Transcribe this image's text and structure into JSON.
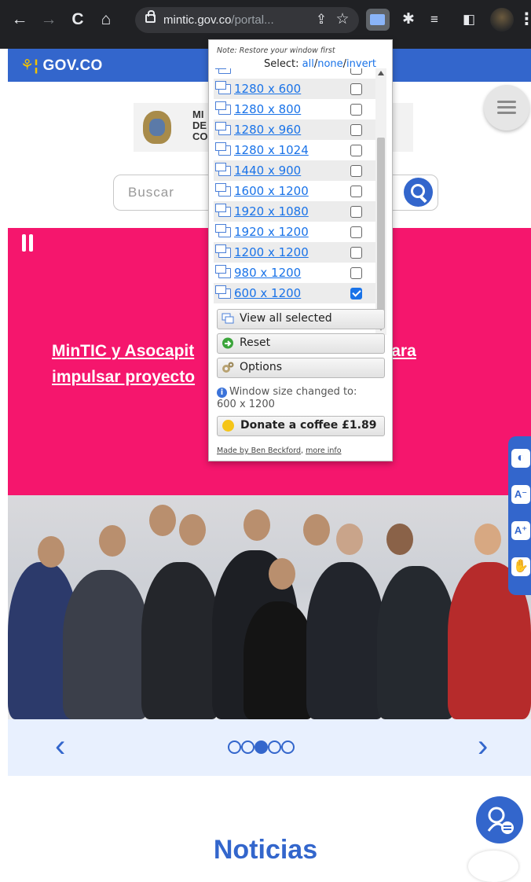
{
  "browser": {
    "url_host": "mintic.gov.co",
    "url_path": "/portal...",
    "icons": [
      "back-icon",
      "forward-icon",
      "reload-icon",
      "home-icon",
      "share-icon",
      "star-icon",
      "window-resizer-icon",
      "extensions-icon",
      "reading-list-icon",
      "side-panel-icon",
      "profile-avatar",
      "menu-icon"
    ]
  },
  "govbar": {
    "logo_text": "GOV.CO"
  },
  "header": {
    "ministry_lines": [
      "MI",
      "DE",
      "CO"
    ],
    "search_placeholder": "Buscar"
  },
  "hero": {
    "title_line1": "MinTIC y Asocapit",
    "title_line1_end": "uipo para",
    "title_line2": "impulsar proyecto"
  },
  "carousel": {
    "prev": "‹",
    "next": "›",
    "dots": 5,
    "active_dot": 3
  },
  "news": {
    "heading": "Noticias"
  },
  "accessibility": {
    "items": [
      "◐",
      "A⁻",
      "A⁺",
      "✋"
    ]
  },
  "popup": {
    "note": "Note: Restore your window first",
    "select_label": "Select:",
    "select_all": "all",
    "select_none": "none",
    "select_invert": "invert",
    "rows": [
      {
        "label": "1280 x 600",
        "checked": false
      },
      {
        "label": "1280 x 800",
        "checked": false
      },
      {
        "label": "1280 x 960",
        "checked": false
      },
      {
        "label": "1280 x 1024",
        "checked": false
      },
      {
        "label": "1440 x 900",
        "checked": false
      },
      {
        "label": "1600 x 1200",
        "checked": false
      },
      {
        "label": "1920 x 1080",
        "checked": false
      },
      {
        "label": "1920 x 1200",
        "checked": false
      },
      {
        "label": "1200 x 1200",
        "checked": false
      },
      {
        "label": "980 x 1200",
        "checked": false
      },
      {
        "label": "600 x 1200",
        "checked": true
      }
    ],
    "view_all": "View all selected",
    "reset": "Reset",
    "options": "Options",
    "status_line1": "Window size changed to:",
    "status_line2": "600 x 1200",
    "donate": "Donate a coffee £1.89",
    "footer_made": "Made by Ben Beckford",
    "footer_more": "more info"
  },
  "colors": {
    "gov_blue": "#3366cc",
    "hero_pink": "#f5166d",
    "link_blue": "#1a73e8"
  }
}
